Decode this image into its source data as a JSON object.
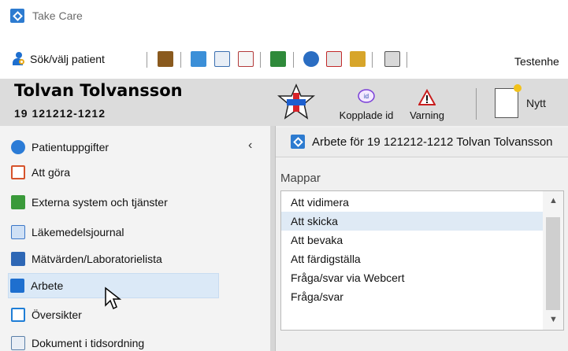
{
  "window": {
    "title": "Take Care"
  },
  "toolbar": {
    "search_label": "Sök/välj patient",
    "trailing_label": "Testenhe"
  },
  "patient": {
    "name": "Tolvan Tolvansson",
    "personnummer": "19 121212-1212"
  },
  "header_buttons": {
    "kopplade_id": "Kopplade id",
    "varning": "Varning",
    "nytt": "Nytt"
  },
  "nav": {
    "items": [
      {
        "label": "Patientuppgifter",
        "icon": "patient-info-icon",
        "color": "#2b7bd6"
      },
      {
        "label": "Att göra",
        "icon": "todo-checklist-icon",
        "color": "#d6532b"
      },
      {
        "label": "Externa system och tjänster",
        "icon": "external-systems-icon",
        "color": "#3a9a3a"
      },
      {
        "label": "Läkemedelsjournal",
        "icon": "medication-icon",
        "color": "#3b77c8"
      },
      {
        "label": "Mätvärden/Laboratorielista",
        "icon": "lab-values-icon",
        "color": "#2e67b5"
      },
      {
        "label": "Arbete",
        "icon": "work-icon",
        "color": "#1e6fcf"
      },
      {
        "label": "Översikter",
        "icon": "overview-icon",
        "color": "#1f7ed6"
      },
      {
        "label": "Dokument i tidsordning",
        "icon": "documents-timeline-icon",
        "color": "#5a7fa8"
      }
    ],
    "collapse_glyph": "‹"
  },
  "work_panel": {
    "title": "Arbete för 19 121212-1212 Tolvan Tolvansson",
    "folders_label": "Mappar",
    "folders": [
      "Att vidimera",
      "Att skicka",
      "Att bevaka",
      "Att färdigställa",
      "Fråga/svar via Webcert",
      "Fråga/svar"
    ],
    "selected_folder": "Att skicka"
  },
  "colors": {
    "accent": "#2d7bd0",
    "selected_row": "#dfeaf5",
    "header_band": "#dcdcdc"
  }
}
